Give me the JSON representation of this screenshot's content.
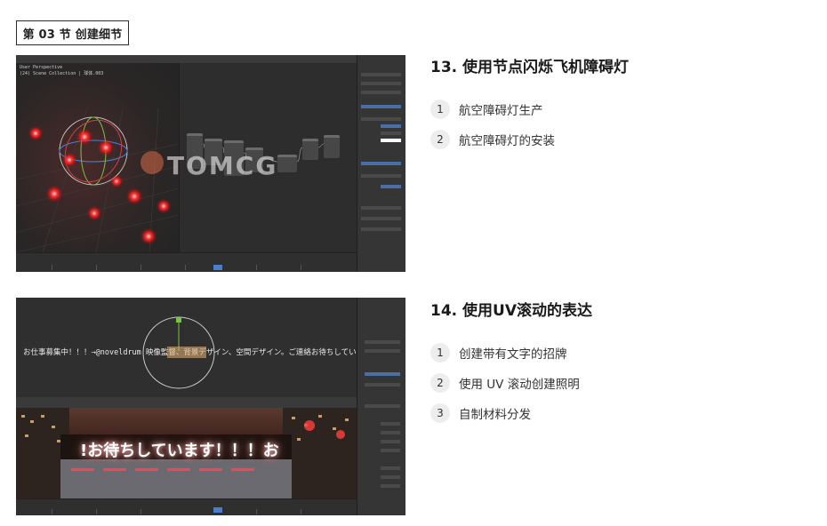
{
  "section_tag": "第 03 节 创建细节",
  "lessons": [
    {
      "title": "13. 使用节点闪烁飞机障碍灯",
      "items": [
        {
          "num": "1",
          "text": "航空障碍灯生产"
        },
        {
          "num": "2",
          "text": "航空障碍灯的安装"
        }
      ]
    },
    {
      "title": "14. 使用UV滚动的表达",
      "items": [
        {
          "num": "1",
          "text": "创建带有文字的招牌"
        },
        {
          "num": "2",
          "text": "使用 UV 滚动创建照明"
        },
        {
          "num": "3",
          "text": "自制材料分发"
        }
      ]
    }
  ],
  "screenshot1": {
    "viewport_header": "User Perspective",
    "viewport_sub": "(24) Scene Collection | 球体.003",
    "watermark": "TOMCG"
  },
  "screenshot2": {
    "banner_text": "お仕事募集中！！！→@noveldrum 映像監督、背景デザイン、空間デザイン。ご連絡お待ちしています！！！",
    "sign_text": "!お待ちしています！！！お"
  },
  "colors": {
    "light_red": "#ff3030",
    "ui_dark": "#2b2b2b",
    "badge_bg": "#ededed"
  }
}
